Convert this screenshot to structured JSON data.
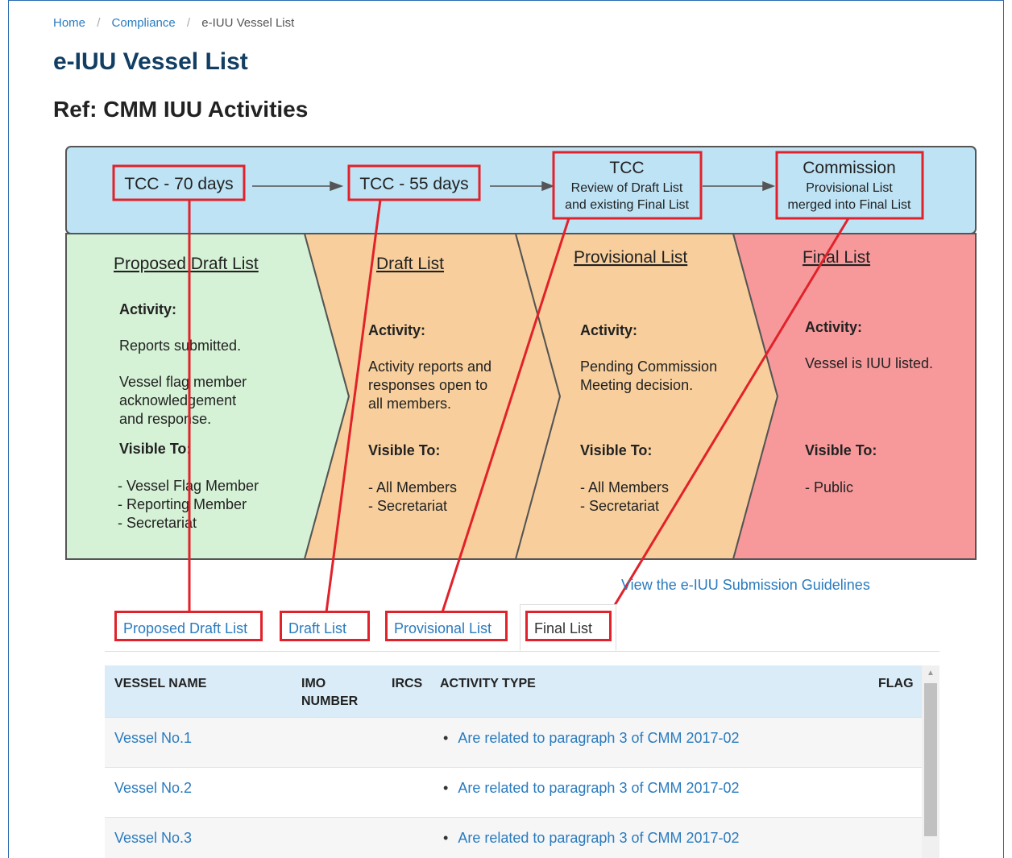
{
  "breadcrumb": {
    "home": "Home",
    "compliance": "Compliance",
    "current": "e-IUU Vessel List",
    "sep": "/"
  },
  "page_title": "e-IUU Vessel List",
  "subtitle": "Ref: CMM IUU Activities",
  "diagram": {
    "colors": {
      "header": "#bde3f5",
      "proposed": "#d5f2d6",
      "draft": "#f8cf9c",
      "provisional": "#f8cf9c",
      "final": "#f7999b",
      "highlight": "#e1222a"
    },
    "timeline": {
      "tcc70": "TCC - 70 days",
      "tcc55": "TCC - 55 days",
      "tcc_title": "TCC",
      "tcc_line1": "Review of Draft List",
      "tcc_line2": "and existing Final List",
      "commission_title": "Commission",
      "commission_line1": "Provisional List",
      "commission_line2": "merged into Final List"
    },
    "proposed": {
      "title": "Proposed Draft List",
      "activity_label": "Activity:",
      "activity_1": "Reports submitted.",
      "activity_2": "Vessel flag member",
      "activity_3": "acknowledgement",
      "activity_4": "and response.",
      "visible_label": "Visible To:",
      "visible_1": "- Vessel Flag Member",
      "visible_2": "- Reporting Member",
      "visible_3": "- Secretariat"
    },
    "draft": {
      "title": "Draft List",
      "activity_label": "Activity:",
      "activity_1": "Activity reports and",
      "activity_2": "responses open to",
      "activity_3": "all members.",
      "visible_label": "Visible To:",
      "visible_1": "- All Members",
      "visible_2": "- Secretariat"
    },
    "provisional": {
      "title": "Provisional List",
      "activity_label": "Activity:",
      "activity_1": "Pending Commission",
      "activity_2": "Meeting decision.",
      "visible_label": "Visible To:",
      "visible_1": "- All Members",
      "visible_2": "- Secretariat"
    },
    "final": {
      "title": "Final List",
      "activity_label": "Activity:",
      "activity_1": "Vessel is IUU listed.",
      "visible_label": "Visible To:",
      "visible_1": "- Public"
    }
  },
  "guidelines_link": "View the e-IUU Submission Guidelines",
  "tabs": [
    {
      "label": "Proposed Draft List"
    },
    {
      "label": "Draft List"
    },
    {
      "label": "Provisional List"
    },
    {
      "label": "Final List",
      "active": true
    }
  ],
  "table": {
    "headers": {
      "vessel_name": "VESSEL NAME",
      "imo_1": "IMO",
      "imo_2": "NUMBER",
      "ircs": "IRCS",
      "activity_type": "ACTIVITY TYPE",
      "flag": "FLAG"
    },
    "rows": [
      {
        "name": "Vessel No.1",
        "activity": "Are related to paragraph 3 of CMM 2017-02"
      },
      {
        "name": "Vessel No.2",
        "activity": "Are related to paragraph 3 of CMM 2017-02"
      },
      {
        "name": "Vessel No.3",
        "activity": "Are related to paragraph 3 of CMM 2017-02"
      }
    ]
  }
}
